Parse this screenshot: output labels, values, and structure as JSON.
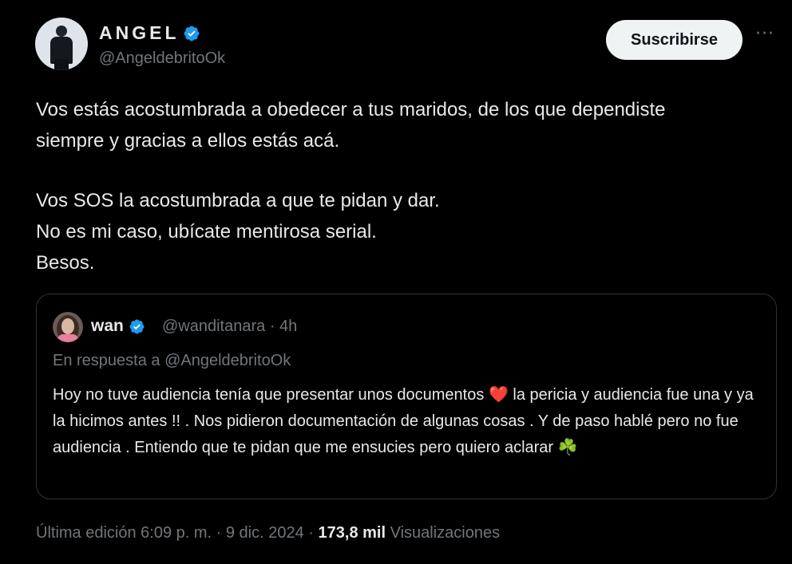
{
  "author": {
    "name": "ANGEL",
    "handle": "@AngeldebritoOk",
    "verified_color": "#1d9bf0"
  },
  "actions": {
    "subscribe_label": "Suscribirse",
    "more_label": "···"
  },
  "tweet": {
    "lines_1": "Vos estás acostumbrada a obedecer a tus maridos, de los que dependiste",
    "lines_2": "siempre y gracias a ellos estás acá.",
    "lines_3": "Vos SOS la acostumbrada a que te pidan y dar.",
    "lines_4": "No es mi caso, ubícate mentirosa serial.",
    "lines_5": "Besos."
  },
  "quote": {
    "name": "wan",
    "meta": "@wanditanara · 4h",
    "reply_to": "En respuesta a @AngeldebritoOk",
    "text_a": "Hoy no tuve audiencia tenía que presentar unos documentos",
    "heart": "❤️",
    "text_b": "la pericia y audiencia fue una y ya la hicimos antes !! . Nos pidieron documentación de algunas cosas . Y de paso hablé pero no fue audiencia . Entiendo que te pidan que me ensucies pero quiero aclarar",
    "clover": "☘️"
  },
  "footer": {
    "edited": "Última edición 6:09 p. m. · 9 dic. 2024 ·",
    "views_count": "173,8 mil",
    "views_label": "Visualizaciones"
  },
  "icons": [
    "verified-badge-icon",
    "more-options-icon",
    "heart-emoji-icon",
    "clover-emoji-icon"
  ]
}
